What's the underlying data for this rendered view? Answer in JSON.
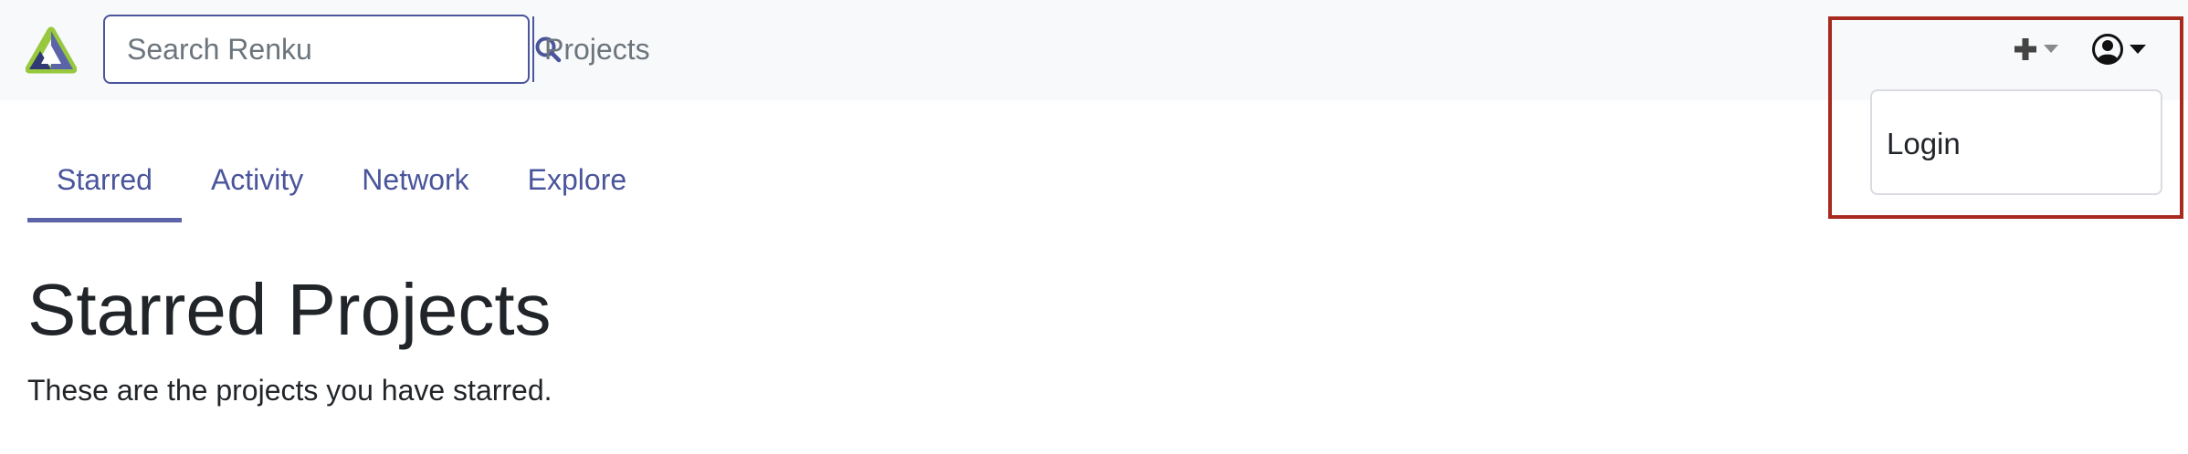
{
  "brand": {
    "logo_icon": "renku-logo-icon",
    "colors": {
      "dark": "#323a73",
      "light": "#98c83e",
      "mid": "#5b64a8"
    }
  },
  "search": {
    "placeholder": "Search Renku",
    "value": "",
    "button_icon": "search-icon"
  },
  "nav": {
    "projects_label": "Projects"
  },
  "header_actions": {
    "plus_icon": "plus-icon",
    "user_icon": "user-circle-icon",
    "caret_icon": "caret-down-icon"
  },
  "user_menu": {
    "items": [
      {
        "label": "Login"
      }
    ],
    "highlight_color": "#a8291e"
  },
  "tabs": [
    {
      "label": "Starred",
      "active": true
    },
    {
      "label": "Activity",
      "active": false
    },
    {
      "label": "Network",
      "active": false
    },
    {
      "label": "Explore",
      "active": false
    }
  ],
  "main": {
    "title": "Starred Projects",
    "subtitle": "These are the projects you have starred."
  },
  "colors": {
    "navbar_bg": "#f8f9fa",
    "accent": "#4a559b",
    "muted_text": "#6c757d"
  }
}
